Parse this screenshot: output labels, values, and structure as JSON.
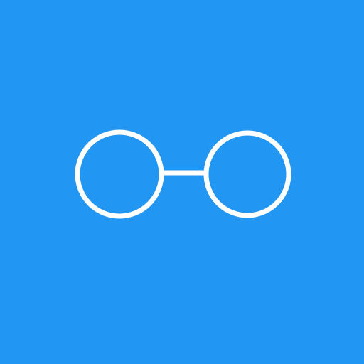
{
  "icon": {
    "name": "glasses-icon",
    "background_color": "#2196F3",
    "stroke_color": "#FFFFFF"
  }
}
